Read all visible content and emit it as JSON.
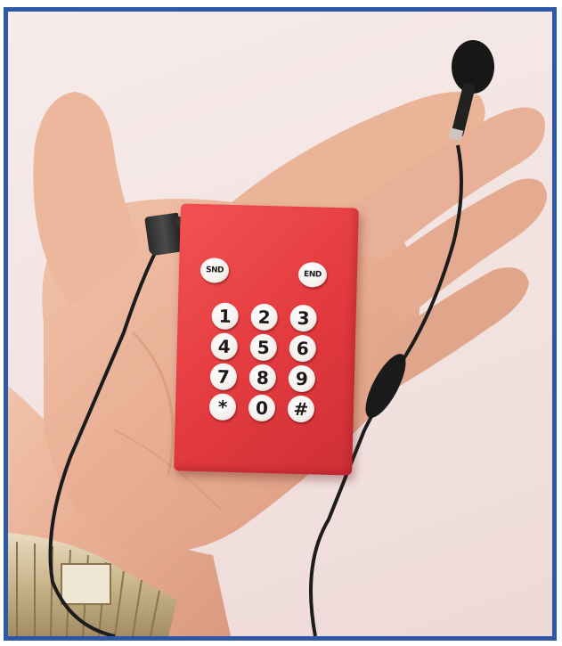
{
  "photo": {
    "subject": "red-keypad-phone-in-hand",
    "colors": {
      "border": "#2f57a8",
      "phone": "#e23a3f",
      "key": "#f4f1ee",
      "skin": "#e9b49a",
      "cable": "#1c1c1c"
    }
  },
  "keypad": {
    "send_label": "SND",
    "end_label": "END",
    "keys": [
      "1",
      "2",
      "3",
      "4",
      "5",
      "6",
      "7",
      "8",
      "9",
      "*",
      "0",
      "#"
    ]
  }
}
